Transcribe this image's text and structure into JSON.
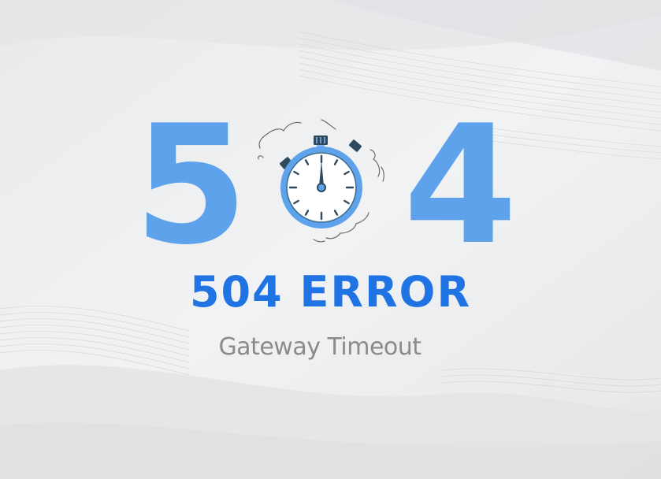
{
  "graphic": {
    "digit_left": "5",
    "digit_right": "4",
    "stopwatch_icon": "stopwatch-icon"
  },
  "error": {
    "title": "504 ERROR",
    "subtitle": "Gateway Timeout"
  },
  "colors": {
    "background": "#eeeff1",
    "digit_blue": "#5da2eb",
    "title_blue": "#1f73e3",
    "subtitle_gray": "#8a8b8d",
    "stopwatch_dark": "#2f4a5c"
  }
}
